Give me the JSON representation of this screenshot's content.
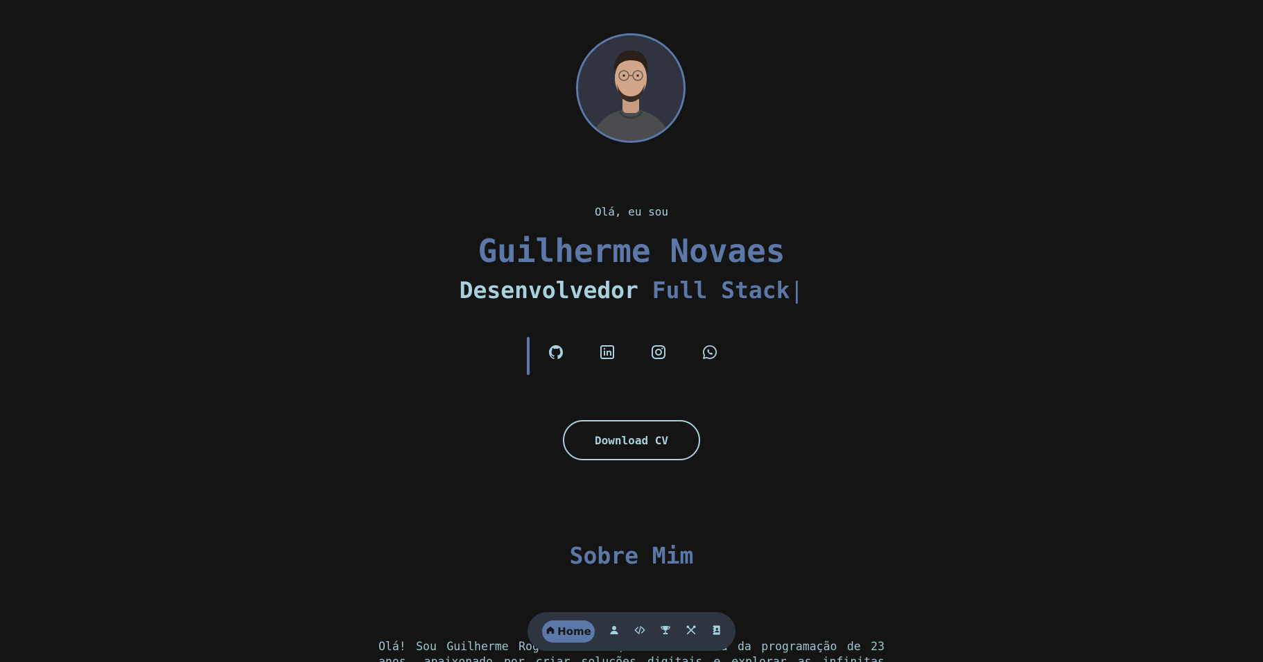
{
  "hero": {
    "greeting": "Olá, eu sou",
    "name": "Guilherme Novaes",
    "role_prefix": "Desenvolvedor",
    "role_highlight": "Full Stack",
    "caret": "|"
  },
  "socials": [
    {
      "icon": "github-icon"
    },
    {
      "icon": "linkedin-icon"
    },
    {
      "icon": "instagram-icon"
    },
    {
      "icon": "whatsapp-icon"
    }
  ],
  "cv_button": {
    "label": "Download CV"
  },
  "about": {
    "title": "Sobre Mim",
    "text": "Olá! Sou Guilherme Rogério Novaes, um entusiasta da programação de 23 anos, apaixonado por criar soluções digitais e explorar as infinitas"
  },
  "nav": {
    "active_label": "Home",
    "items": [
      "home-icon",
      "user-icon",
      "code-icon",
      "trophy-icon",
      "tools-icon",
      "contact-book-icon"
    ]
  },
  "colors": {
    "background": "#141415",
    "primary": "#5b78a8",
    "accent": "#a7d1dc",
    "nav_background": "#2e3440"
  }
}
